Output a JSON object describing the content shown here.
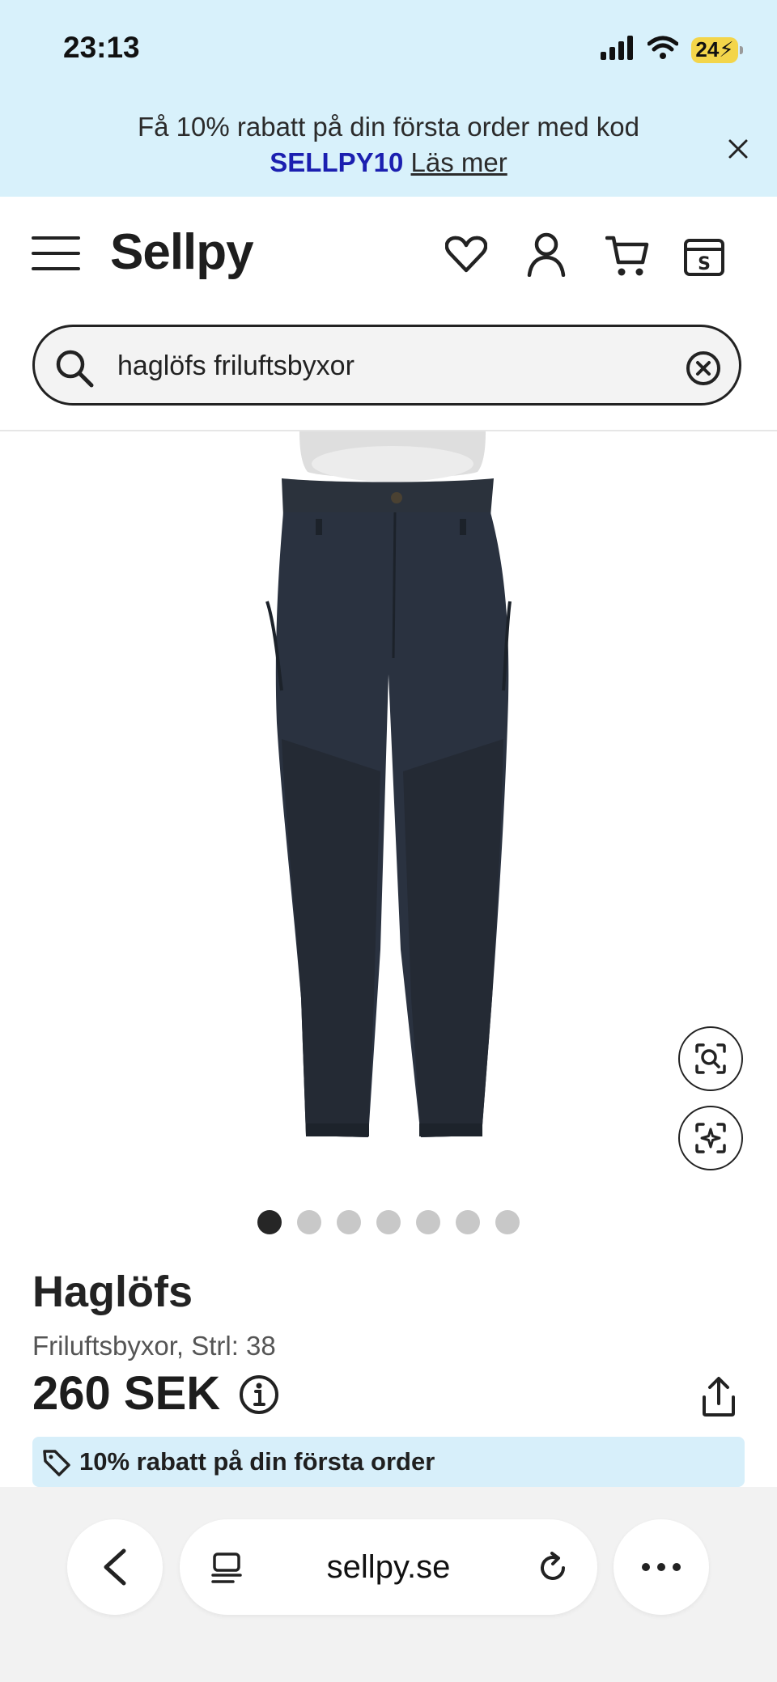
{
  "status_bar": {
    "time": "23:13",
    "battery": "24"
  },
  "promo": {
    "text": "Få 10% rabatt på din första order med kod",
    "code": "SELLPY10",
    "link": "Läs mer"
  },
  "header": {
    "logo": "Sellpy"
  },
  "search": {
    "value": "haglöfs friluftsbyxor"
  },
  "gallery": {
    "image_count": 7,
    "active_index": 0
  },
  "product": {
    "brand": "Haglöfs",
    "subtitle": "Friluftsbyxor, Strl: 38",
    "price": "260 SEK"
  },
  "discount": {
    "text": "10% rabatt på din första order"
  },
  "browser": {
    "url": "sellpy.se"
  },
  "colors": {
    "accent_bg": "#d8f1fb",
    "promo_code": "#1b1fb0",
    "pants": "#2a3240"
  }
}
